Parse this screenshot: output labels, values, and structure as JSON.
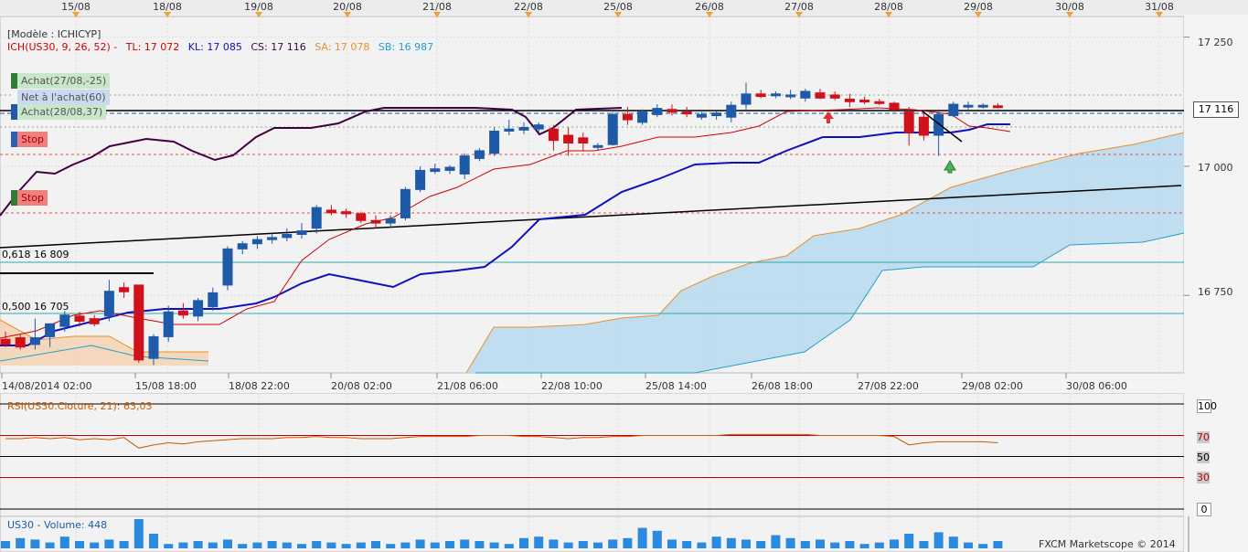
{
  "header": {
    "model_label": "[Modèle : ICHICYP]",
    "ich": {
      "label": "ICH(US30, 9, 26, 52) -",
      "tl": "TL: 17 072",
      "kl": "KL: 17 085",
      "cs": "CS: 17 116",
      "sa": "SA: 17 078",
      "sb": "SB: 16 987"
    },
    "colors": {
      "ich": "#d00000",
      "tl": "#d00000",
      "kl": "#1010c0",
      "cs": "#400040",
      "sa": "#e8902a",
      "sb": "#20a0d0"
    }
  },
  "top_dates": [
    "15/08",
    "18/08",
    "19/08",
    "20/08",
    "21/08",
    "22/08",
    "25/08",
    "26/08",
    "27/08",
    "28/08",
    "29/08",
    "30/08",
    "31/08"
  ],
  "orders": [
    {
      "label": "Achat(27/08,-25)",
      "bar_color": "#2e7d32",
      "bg": "#c8e6c9"
    },
    {
      "label": "Net à l'achat(60)",
      "bar_color": "#1e5aa8",
      "bg": "#c9d9f0"
    },
    {
      "label": "Achat(28/08,37)",
      "bar_color": "#1e5aa8",
      "bg": "#c8e6c9"
    },
    {
      "label": "Stop",
      "bar_color": "#3060b0",
      "bg": "#f08080"
    },
    {
      "label": "Stop",
      "bar_color": "#2e7d32",
      "bg": "#f08080"
    }
  ],
  "fib_labels": [
    "0,618 16 809",
    "0,500 16 705"
  ],
  "price_axis": {
    "ticks": [
      "17 250",
      "17 000",
      "16 750"
    ],
    "current": "17 116"
  },
  "bottom_dates": [
    "14/08/2014 02:00",
    "15/08 18:00",
    "18/08 22:00",
    "20/08 02:00",
    "21/08 06:00",
    "22/08 10:00",
    "25/08 14:00",
    "26/08 18:00",
    "27/08 22:00",
    "29/08 02:00",
    "30/08 06:00"
  ],
  "rsi": {
    "title": "RSI(US30.Cloture, 21): 63,03",
    "levels": [
      "100",
      "70",
      "50",
      "30",
      "0"
    ]
  },
  "volume": {
    "title": "US30 - Volume: 448"
  },
  "footer": {
    "brand": "FXCM Marketscope © 2014"
  },
  "chart_data": [
    {
      "type": "candlestick",
      "title": "",
      "ylim": [
        16600,
        17290
      ],
      "candles": [
        {
          "o": 16665,
          "h": 16680,
          "l": 16650,
          "c": 16655
        },
        {
          "o": 16668,
          "h": 16675,
          "l": 16645,
          "c": 16650
        },
        {
          "o": 16655,
          "h": 16705,
          "l": 16645,
          "c": 16668
        },
        {
          "o": 16670,
          "h": 16690,
          "l": 16650,
          "c": 16695
        },
        {
          "o": 16690,
          "h": 16720,
          "l": 16680,
          "c": 16712
        },
        {
          "o": 16710,
          "h": 16718,
          "l": 16690,
          "c": 16700
        },
        {
          "o": 16705,
          "h": 16712,
          "l": 16690,
          "c": 16695
        },
        {
          "o": 16710,
          "h": 16780,
          "l": 16700,
          "c": 16758
        },
        {
          "o": 16765,
          "h": 16775,
          "l": 16745,
          "c": 16757
        },
        {
          "o": 16770,
          "h": 16770,
          "l": 16620,
          "c": 16625
        },
        {
          "o": 16628,
          "h": 16675,
          "l": 16615,
          "c": 16670
        },
        {
          "o": 16670,
          "h": 16730,
          "l": 16660,
          "c": 16718
        },
        {
          "o": 16720,
          "h": 16735,
          "l": 16705,
          "c": 16712
        },
        {
          "o": 16710,
          "h": 16745,
          "l": 16700,
          "c": 16740
        },
        {
          "o": 16728,
          "h": 16765,
          "l": 16720,
          "c": 16755
        },
        {
          "o": 16770,
          "h": 16845,
          "l": 16760,
          "c": 16840
        },
        {
          "o": 16840,
          "h": 16855,
          "l": 16830,
          "c": 16850
        },
        {
          "o": 16850,
          "h": 16865,
          "l": 16840,
          "c": 16858
        },
        {
          "o": 16858,
          "h": 16870,
          "l": 16850,
          "c": 16862
        },
        {
          "o": 16862,
          "h": 16880,
          "l": 16855,
          "c": 16868
        },
        {
          "o": 16868,
          "h": 16890,
          "l": 16860,
          "c": 16875
        },
        {
          "o": 16880,
          "h": 16925,
          "l": 16870,
          "c": 16920
        },
        {
          "o": 16915,
          "h": 16925,
          "l": 16905,
          "c": 16910
        },
        {
          "o": 16912,
          "h": 16918,
          "l": 16900,
          "c": 16908
        },
        {
          "o": 16908,
          "h": 16912,
          "l": 16890,
          "c": 16895
        },
        {
          "o": 16895,
          "h": 16905,
          "l": 16880,
          "c": 16890
        },
        {
          "o": 16890,
          "h": 16905,
          "l": 16880,
          "c": 16898
        },
        {
          "o": 16900,
          "h": 16960,
          "l": 16895,
          "c": 16955
        },
        {
          "o": 16955,
          "h": 17000,
          "l": 16950,
          "c": 16992
        },
        {
          "o": 16990,
          "h": 17005,
          "l": 16985,
          "c": 16995
        },
        {
          "o": 16992,
          "h": 17002,
          "l": 16985,
          "c": 16998
        },
        {
          "o": 16985,
          "h": 17025,
          "l": 16975,
          "c": 17020
        },
        {
          "o": 17015,
          "h": 17035,
          "l": 17010,
          "c": 17030
        },
        {
          "o": 17025,
          "h": 17075,
          "l": 17020,
          "c": 17068
        },
        {
          "o": 17068,
          "h": 17090,
          "l": 17060,
          "c": 17072
        },
        {
          "o": 17070,
          "h": 17085,
          "l": 17062,
          "c": 17075
        },
        {
          "o": 17072,
          "h": 17085,
          "l": 17065,
          "c": 17080
        },
        {
          "o": 17072,
          "h": 17080,
          "l": 17030,
          "c": 17050
        },
        {
          "o": 17060,
          "h": 17075,
          "l": 17020,
          "c": 17045
        },
        {
          "o": 17055,
          "h": 17065,
          "l": 17030,
          "c": 17045
        },
        {
          "o": 17038,
          "h": 17045,
          "l": 17030,
          "c": 17040
        },
        {
          "o": 17042,
          "h": 17105,
          "l": 17040,
          "c": 17100
        },
        {
          "o": 17100,
          "h": 17115,
          "l": 17080,
          "c": 17090
        },
        {
          "o": 17085,
          "h": 17110,
          "l": 17080,
          "c": 17105
        },
        {
          "o": 17100,
          "h": 17120,
          "l": 17095,
          "c": 17112
        },
        {
          "o": 17110,
          "h": 17120,
          "l": 17098,
          "c": 17105
        },
        {
          "o": 17105,
          "h": 17115,
          "l": 17095,
          "c": 17102
        },
        {
          "o": 17095,
          "h": 17105,
          "l": 17090,
          "c": 17100
        },
        {
          "o": 17098,
          "h": 17108,
          "l": 17090,
          "c": 17103
        },
        {
          "o": 17095,
          "h": 17125,
          "l": 17085,
          "c": 17118
        },
        {
          "o": 17120,
          "h": 17162,
          "l": 17110,
          "c": 17140
        },
        {
          "o": 17140,
          "h": 17148,
          "l": 17132,
          "c": 17135
        },
        {
          "o": 17138,
          "h": 17145,
          "l": 17132,
          "c": 17140
        },
        {
          "o": 17135,
          "h": 17148,
          "l": 17130,
          "c": 17138
        },
        {
          "o": 17132,
          "h": 17150,
          "l": 17125,
          "c": 17145
        },
        {
          "o": 17142,
          "h": 17150,
          "l": 17130,
          "c": 17132
        },
        {
          "o": 17138,
          "h": 17145,
          "l": 17128,
          "c": 17132
        },
        {
          "o": 17130,
          "h": 17140,
          "l": 17115,
          "c": 17125
        },
        {
          "o": 17128,
          "h": 17135,
          "l": 17120,
          "c": 17125
        },
        {
          "o": 17125,
          "h": 17130,
          "l": 17118,
          "c": 17122
        },
        {
          "o": 17122,
          "h": 17125,
          "l": 17105,
          "c": 17110
        },
        {
          "o": 17105,
          "h": 17115,
          "l": 17040,
          "c": 17065
        },
        {
          "o": 17095,
          "h": 17105,
          "l": 17050,
          "c": 17060
        },
        {
          "o": 17060,
          "h": 17110,
          "l": 17020,
          "c": 17100
        },
        {
          "o": 17098,
          "h": 17125,
          "l": 17095,
          "c": 17120
        },
        {
          "o": 17115,
          "h": 17125,
          "l": 17110,
          "c": 17118
        },
        {
          "o": 17116,
          "h": 17122,
          "l": 17112,
          "c": 17118
        },
        {
          "o": 17117,
          "h": 17122,
          "l": 17112,
          "c": 17116
        }
      ]
    },
    {
      "type": "line",
      "title": "RSI(US30.Cloture, 21): 63,03",
      "ylim": [
        0,
        100
      ],
      "series": [
        {
          "name": "RSI(US30.Cloture, 21)",
          "values": [
            67,
            67,
            68,
            67,
            68,
            66,
            67,
            66,
            68,
            58,
            61,
            63,
            62,
            64,
            65,
            66,
            67,
            67,
            67,
            68,
            68,
            69,
            68,
            68,
            67,
            67,
            67,
            68,
            69,
            69,
            69,
            69,
            70,
            70,
            70,
            69,
            69,
            68,
            67,
            68,
            68,
            69,
            69,
            70,
            70,
            70,
            70,
            70,
            70,
            71,
            71,
            71,
            71,
            71,
            71,
            70,
            70,
            70,
            70,
            70,
            69,
            61,
            63,
            64,
            64,
            64,
            64,
            63
          ]
        }
      ]
    },
    {
      "type": "bar",
      "title": "US30 - Volume: 448",
      "series": [
        {
          "name": "US30 - Volume",
          "values": [
            5,
            7,
            6,
            4,
            8,
            5,
            4,
            6,
            5,
            20,
            10,
            3,
            4,
            5,
            4,
            6,
            3,
            4,
            5,
            4,
            3,
            5,
            4,
            3,
            4,
            5,
            3,
            4,
            6,
            4,
            5,
            6,
            5,
            4,
            3,
            7,
            8,
            6,
            4,
            5,
            4,
            6,
            7,
            14,
            12,
            6,
            5,
            4,
            8,
            7,
            6,
            5,
            9,
            7,
            5,
            6,
            4,
            5,
            3,
            4,
            6,
            10,
            5,
            11,
            8,
            4,
            3,
            5
          ]
        }
      ]
    }
  ]
}
